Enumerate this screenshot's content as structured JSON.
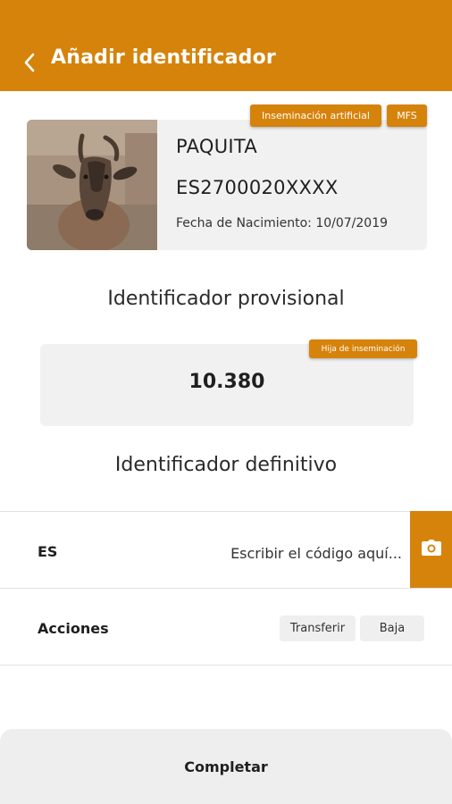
{
  "header": {
    "title": "Añadir identificador",
    "back_icon": "chevron-left-icon",
    "background": "#d6830c"
  },
  "animal": {
    "name": "PAQUITA",
    "id": "ES2700020XXXX",
    "birth_date": "Fecha de Nacimiento: 10/07/2019",
    "tags": [
      "Inseminación artificial",
      "MFS"
    ]
  },
  "provisional": {
    "title": "Identificador provisional",
    "badge": "Hija de inseminación",
    "value": "10.380"
  },
  "definitive": {
    "title": "Identificador definitivo",
    "country_label": "ES",
    "placeholder": "Escribir el código aquí...",
    "camera_icon": "camera-icon"
  },
  "actions": {
    "label": "Acciones",
    "transfer": "Transferir",
    "baja": "Baja"
  },
  "footer": {
    "complete": "Completar"
  }
}
